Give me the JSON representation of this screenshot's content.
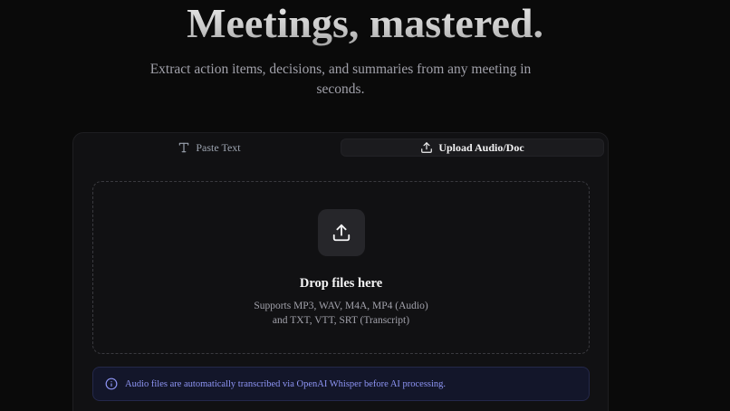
{
  "hero": {
    "title": "Meetings, mastered.",
    "subtitle": "Extract action items, decisions, and summaries from any meeting in seconds."
  },
  "tabs": [
    {
      "label": "Paste Text",
      "icon": "text-type-icon",
      "active": false
    },
    {
      "label": "Upload Audio/Doc",
      "icon": "upload-icon",
      "active": true
    }
  ],
  "dropzone": {
    "icon": "upload-icon",
    "title": "Drop files here",
    "line1": "Supports MP3, WAV, M4A, MP4 (Audio)",
    "line2": "and TXT, VTT, SRT (Transcript)"
  },
  "notice": {
    "icon": "info-circle-icon",
    "text": "Audio files are automatically transcribed via OpenAI Whisper before AI processing."
  },
  "colors": {
    "background": "#0a0a0a",
    "card": "#111113",
    "notice_bg": "#13162a",
    "notice_text": "#8e95f5"
  }
}
